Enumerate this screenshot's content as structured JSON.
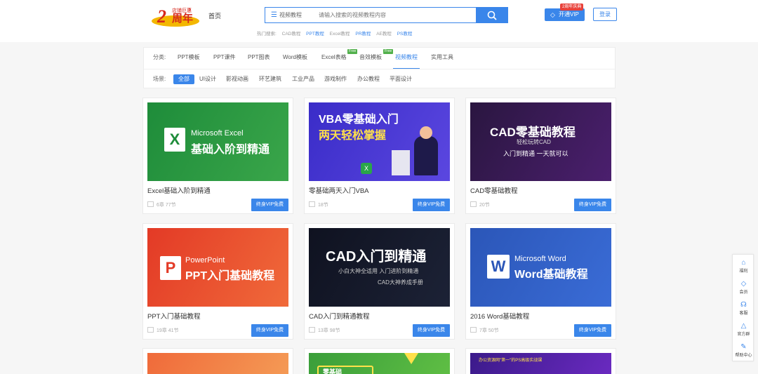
{
  "header": {
    "logo": {
      "num": "2",
      "text": "周年",
      "small": "店铺巨惠"
    },
    "nav_home": "首页",
    "search": {
      "type_label": "视频教程",
      "placeholder": "请输入搜索的视频教程内容"
    },
    "hot_label": "热门搜索:",
    "hot_items": [
      "CAD教程",
      "PPT教程",
      "Excel教程",
      "PR教程",
      "AE教程",
      "PS教程"
    ],
    "vip_button": "开通VIP",
    "vip_badge": "2周年庆典",
    "login_button": "登录"
  },
  "filters": {
    "category_label": "分类:",
    "categories": [
      "PPT模板",
      "PPT课件",
      "PPT图表",
      "Word模板",
      "Excel表格",
      "音效模板",
      "视频教程",
      "实用工具"
    ],
    "free_badge": "Free",
    "scene_label": "场景:",
    "scenes": [
      "全部",
      "UI设计",
      "影视动画",
      "环艺建筑",
      "工业产品",
      "游戏制作",
      "办公教程",
      "平面设计"
    ]
  },
  "cards": [
    {
      "title": "Excel基础入阶到精通",
      "meta": "6章 77节",
      "button": "终身VIP免费",
      "thumb": {
        "line1": "Microsoft Excel",
        "line2": "基础入阶到精通",
        "logo": "X",
        "bg1": "#1e8c3a",
        "bg2": "#3aa64a"
      }
    },
    {
      "title": "零基础两天入门VBA",
      "meta": "18节",
      "button": "终身VIP免费",
      "thumb": {
        "line1": "VBA零基础入门",
        "line2": "两天轻松掌握",
        "bg1": "#3a2cc8",
        "bg2": "#5b47e0"
      }
    },
    {
      "title": "CAD零基础教程",
      "meta": "20节",
      "button": "终身VIP免费",
      "thumb": {
        "line1": "CAD零基础教程",
        "line2": "轻松玩转CAD",
        "line3": "入门到精通 一天就可以",
        "bg1": "#2a1640",
        "bg2": "#4b1f6e"
      }
    },
    {
      "title": "PPT入门基础教程",
      "meta": "19章 41节",
      "button": "终身VIP免费",
      "thumb": {
        "line1": "PowerPoint",
        "line2": "PPT入门基础教程",
        "logo": "P",
        "bg1": "#e33a26",
        "bg2": "#f06a3a"
      }
    },
    {
      "title": "CAD入门到精通教程",
      "meta": "13章 98节",
      "button": "终身VIP免费",
      "thumb": {
        "line1": "CAD入门到精通",
        "line2": "小白大神全适用 入门进阶到精通",
        "line3": "CAD大神养成手册",
        "bg1": "#0f1220",
        "bg2": "#1c2236"
      }
    },
    {
      "title": "2016 Word基础教程",
      "meta": "7章 50节",
      "button": "终身VIP免费",
      "thumb": {
        "line1": "Microsoft Word",
        "line2": "Word基础教程",
        "logo": "W",
        "bg1": "#2b56b8",
        "bg2": "#3a6cd6"
      }
    },
    {
      "thumb": {
        "bg1": "#f06a3a",
        "bg2": "#f49a55"
      }
    },
    {
      "thumb": {
        "line1": "零基础",
        "bg1": "#3a9e3a",
        "bg2": "#5fbe44"
      }
    },
    {
      "thumb": {
        "line1": "办公资源网\"第一\"的PS高级实战课",
        "bg1": "#3b1a8a",
        "bg2": "#6a2ac0"
      }
    }
  ],
  "sidebar": [
    {
      "label": "福利",
      "icon": "gift-icon"
    },
    {
      "label": "会员",
      "icon": "diamond-icon"
    },
    {
      "label": "客服",
      "icon": "headset-icon"
    },
    {
      "label": "官方群",
      "icon": "bell-icon"
    },
    {
      "label": "帮助中心",
      "icon": "pen-icon"
    }
  ],
  "colors": {
    "accent": "#3a86ea",
    "badge_red": "#e8413a",
    "free_green": "#52b04c"
  }
}
